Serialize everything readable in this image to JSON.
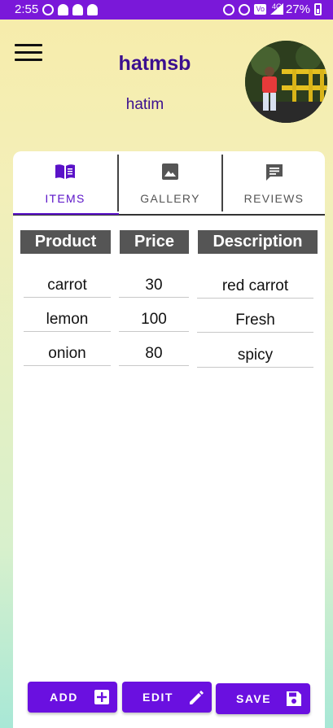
{
  "status_bar": {
    "time": "2:55",
    "network_label": "4G",
    "battery": "27%"
  },
  "header": {
    "menu_icon": "hamburger-menu-icon",
    "username": "hatmsb",
    "subname": "hatim",
    "avatar": "profile-avatar"
  },
  "tabs": [
    {
      "label": "ITEMS",
      "icon": "book-icon",
      "active": true
    },
    {
      "label": "GALLERY",
      "icon": "image-icon",
      "active": false
    },
    {
      "label": "REVIEWS",
      "icon": "comment-icon",
      "active": false
    }
  ],
  "table": {
    "headers": [
      "Product",
      "Price",
      "Description"
    ],
    "rows": [
      [
        "carrot",
        "30",
        "red carrot"
      ],
      [
        "lemon",
        "100",
        "Fresh"
      ],
      [
        "onion",
        "80",
        "spicy"
      ]
    ]
  },
  "actions": {
    "add_label": "ADD",
    "edit_label": "EDIT",
    "save_label": "SAVE"
  },
  "colors": {
    "status_bar": "#7a18d9",
    "accent": "#5a12c8",
    "button": "#6a10e0",
    "header_bg": "#555555"
  }
}
